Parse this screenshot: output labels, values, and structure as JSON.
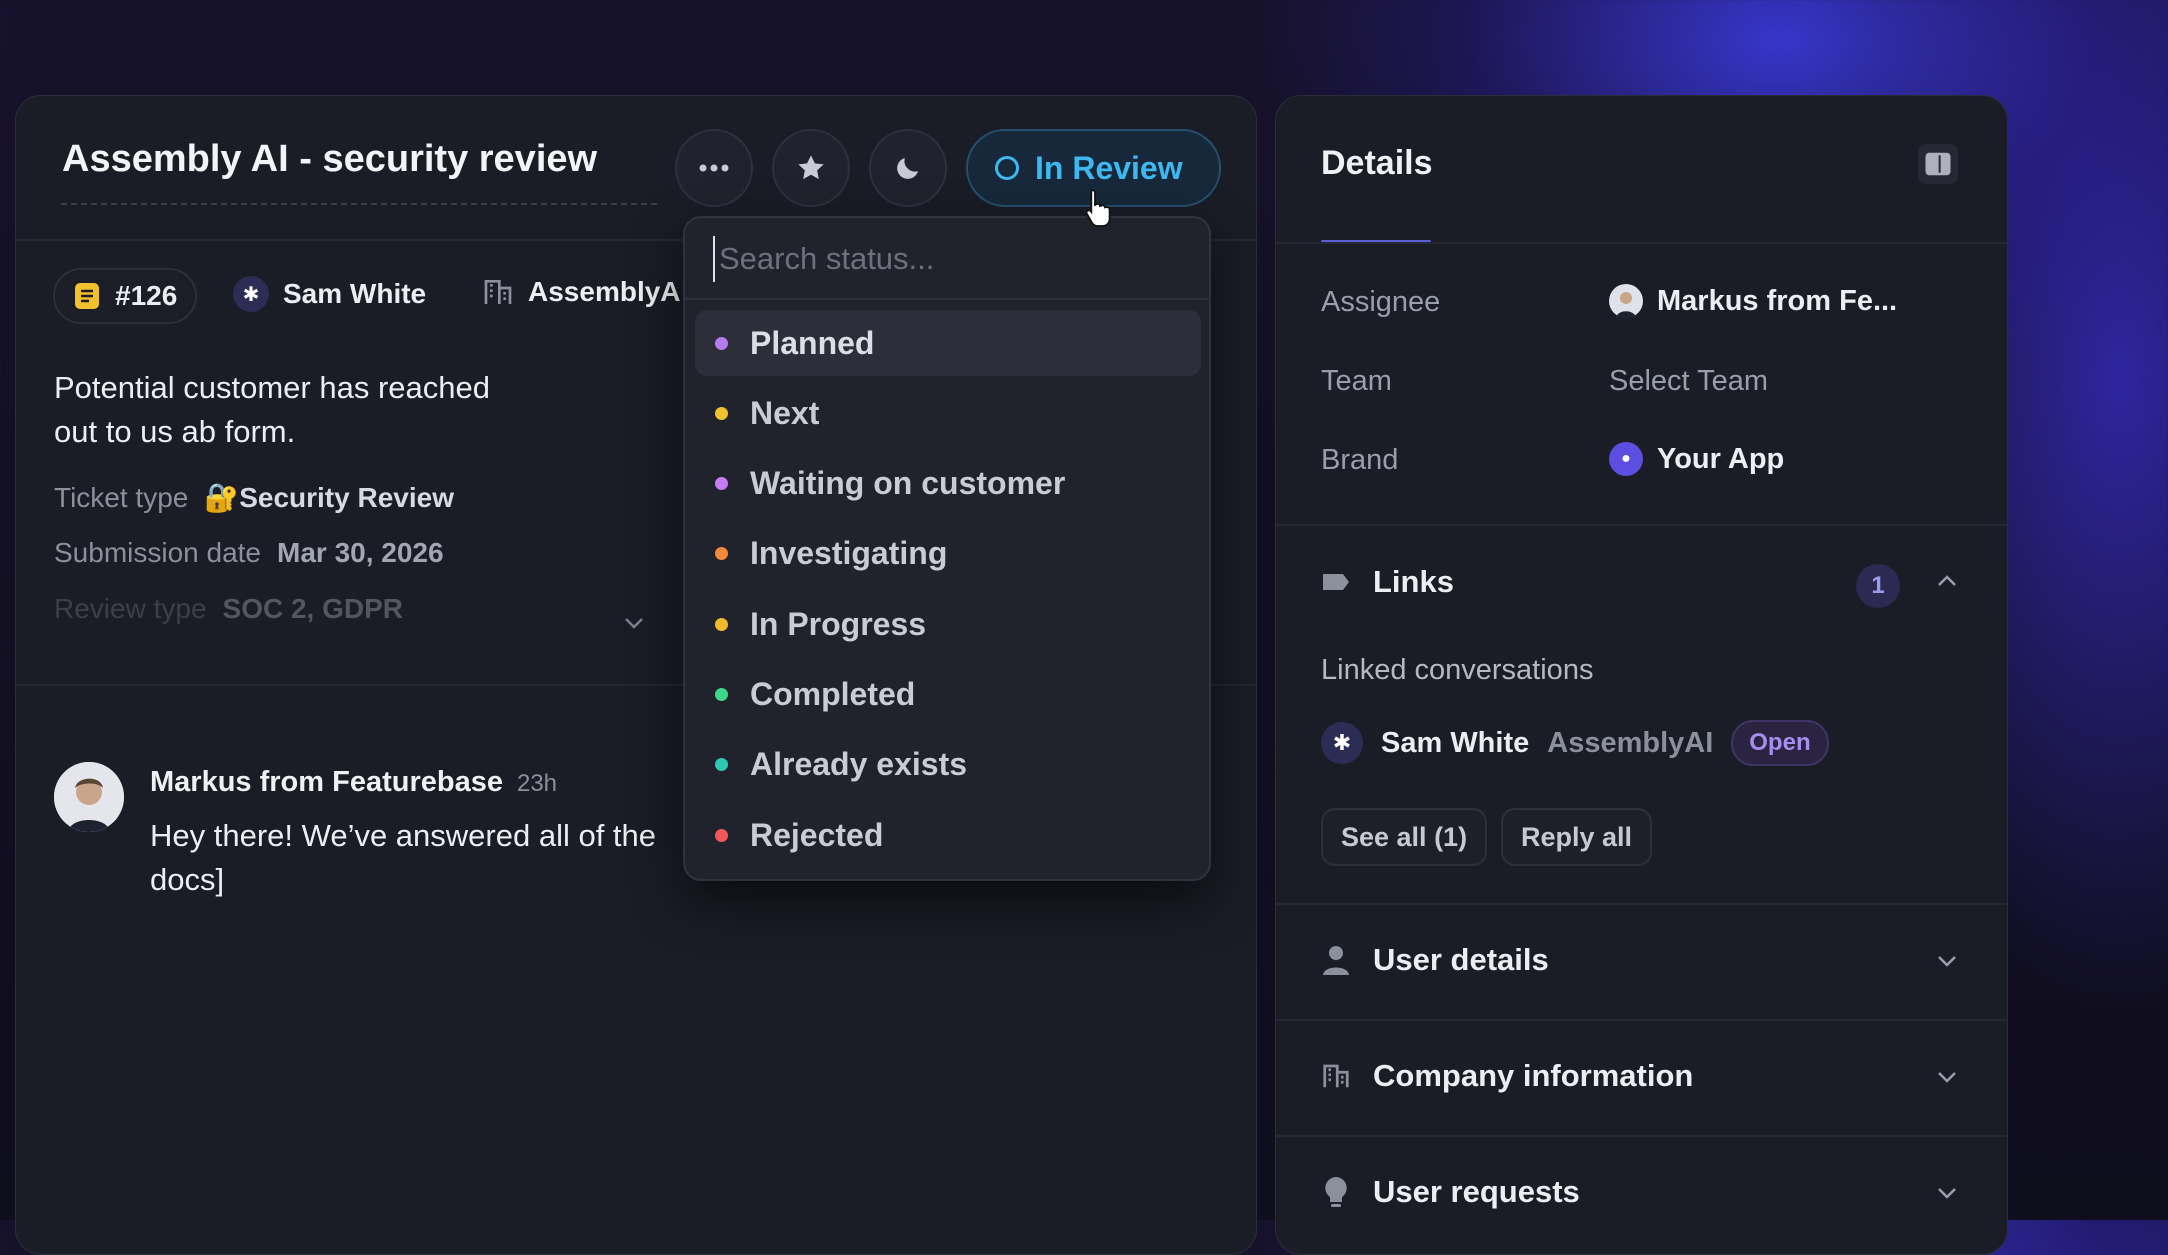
{
  "ticket": {
    "title": "Assembly AI - security review",
    "status_label": "In Review",
    "id_label": "#126",
    "user_name": "Sam White",
    "company_name": "AssemblyA",
    "description": "Potential customer has reached out to us ab form.",
    "fields": [
      {
        "label": "Ticket type",
        "value": "🔐Security Review"
      },
      {
        "label": "Submission date",
        "value": "Mar 30, 2026"
      },
      {
        "label": "Review type",
        "value": "SOC 2, GDPR"
      }
    ]
  },
  "comment": {
    "author": "Markus from Featurebase",
    "time": "23h",
    "text": "Hey there! We’ve answered all of the docs]"
  },
  "status_dropdown": {
    "search_placeholder": "Search status...",
    "options": [
      {
        "label": "Planned",
        "color": "#b57cf2"
      },
      {
        "label": "Next",
        "color": "#f2c12e"
      },
      {
        "label": "Waiting on customer",
        "color": "#c77df2"
      },
      {
        "label": "Investigating",
        "color": "#f28a3a"
      },
      {
        "label": "In Progress",
        "color": "#f2b92e"
      },
      {
        "label": "Completed",
        "color": "#3ed68a"
      },
      {
        "label": "Already exists",
        "color": "#2ec9b5"
      },
      {
        "label": "Rejected",
        "color": "#f2585a"
      }
    ]
  },
  "details": {
    "title": "Details",
    "assignee_label": "Assignee",
    "assignee_value": "Markus from Fe...",
    "team_label": "Team",
    "team_value": "Select Team",
    "brand_label": "Brand",
    "brand_value": "Your App",
    "links_title": "Links",
    "links_count": "1",
    "linked_conversations_label": "Linked conversations",
    "linked_user": "Sam White",
    "linked_company": "AssemblyAI",
    "linked_status": "Open",
    "see_all_label": "See all  (1)",
    "reply_all_label": "Reply all",
    "user_details_title": "User details",
    "company_info_title": "Company information",
    "user_requests_title": "User requests"
  },
  "icons": [
    "more-icon",
    "star-icon",
    "moon-icon",
    "status-ring-icon",
    "ticket-icon",
    "sparkle-icon",
    "building-icon",
    "panel-toggle-icon",
    "link-icon",
    "chevron-up-icon",
    "chevron-down-icon",
    "user-icon",
    "lightbulb-icon",
    "pointer-cursor-icon"
  ]
}
